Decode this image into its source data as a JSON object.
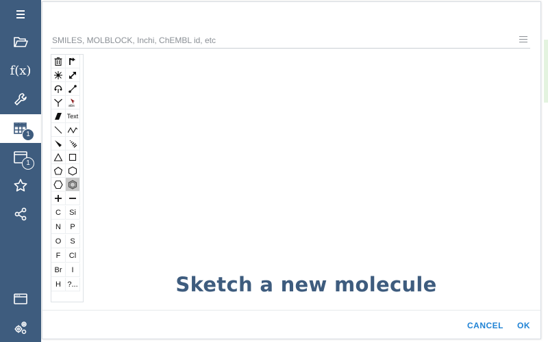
{
  "sidebar": {
    "items": [
      {
        "name": "menu-icon"
      },
      {
        "name": "folder-open-icon"
      },
      {
        "name": "function-icon",
        "label": "f(x)"
      },
      {
        "name": "wrench-icon"
      },
      {
        "name": "table-icon",
        "badge": "1",
        "active": true
      },
      {
        "name": "window-icon",
        "badge": "1"
      },
      {
        "name": "star-icon"
      },
      {
        "name": "share-icon"
      },
      {
        "name": "browser-icon"
      },
      {
        "name": "settings-gears-icon"
      }
    ]
  },
  "dialog": {
    "smiles_placeholder": "SMILES, MOLBLOCK, Inchi, ChEMBL id, etc",
    "smiles_value": "",
    "canvas_hint": "Sketch a new molecule",
    "cancel_label": "CANCEL",
    "ok_label": "OK"
  },
  "palette": {
    "rows": [
      [
        "delete-icon",
        "undo-icon"
      ],
      [
        "radical-icon",
        "resize-icon"
      ],
      [
        "rotate-icon",
        "bond-line-icon"
      ],
      [
        "fork-icon",
        "abs-stereo-icon"
      ],
      [
        "eraser-icon",
        "Text"
      ],
      [
        "single-bond-icon",
        "chain-icon"
      ],
      [
        "wedge-bond-icon",
        "hash-bond-icon"
      ],
      [
        "triangle-icon",
        "square-icon"
      ],
      [
        "pentagon-icon",
        "hexagon-icon"
      ],
      [
        "cyclohexane-icon",
        "benzene-icon"
      ],
      [
        "plus-charge-icon",
        "minus-charge-icon"
      ],
      [
        "C",
        "Si"
      ],
      [
        "N",
        "P"
      ],
      [
        "O",
        "S"
      ],
      [
        "F",
        "Cl"
      ],
      [
        "Br",
        "I"
      ],
      [
        "H",
        "?..."
      ]
    ],
    "elements": {
      "text": "Text",
      "c": "C",
      "si": "Si",
      "n": "N",
      "p": "P",
      "o": "O",
      "s": "S",
      "f": "F",
      "cl": "Cl",
      "br": "Br",
      "i": "I",
      "h": "H",
      "more": "?..."
    },
    "selected_tool": "benzene-icon"
  },
  "colors": {
    "sidebar_bg": "#3e5c7e",
    "hint_text": "#3e5c7e",
    "button_text": "#2083d5"
  }
}
